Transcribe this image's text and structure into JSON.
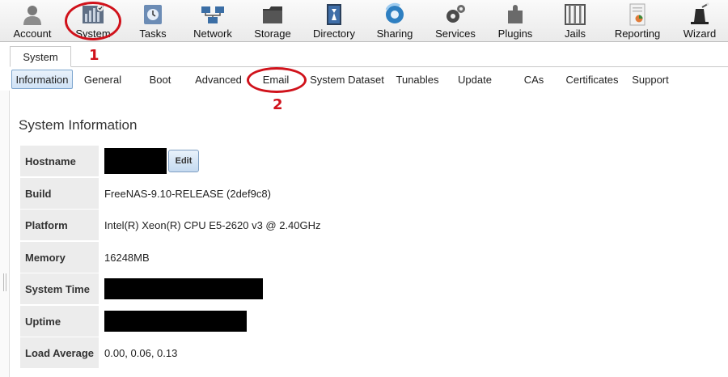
{
  "toolbar": {
    "items": [
      {
        "label": "Account",
        "icon": "account-icon"
      },
      {
        "label": "System",
        "icon": "system-icon"
      },
      {
        "label": "Tasks",
        "icon": "tasks-icon"
      },
      {
        "label": "Network",
        "icon": "network-icon"
      },
      {
        "label": "Storage",
        "icon": "storage-icon"
      },
      {
        "label": "Directory",
        "icon": "directory-icon"
      },
      {
        "label": "Sharing",
        "icon": "sharing-icon"
      },
      {
        "label": "Services",
        "icon": "services-icon"
      },
      {
        "label": "Plugins",
        "icon": "plugins-icon"
      },
      {
        "label": "Jails",
        "icon": "jails-icon"
      },
      {
        "label": "Reporting",
        "icon": "reporting-icon"
      },
      {
        "label": "Wizard",
        "icon": "wizard-icon"
      }
    ]
  },
  "tabs": {
    "main": "System"
  },
  "subtabs": [
    {
      "label": "Information",
      "active": true
    },
    {
      "label": "General"
    },
    {
      "label": "Boot"
    },
    {
      "label": "Advanced"
    },
    {
      "label": "Email"
    },
    {
      "label": "System Dataset"
    },
    {
      "label": "Tunables"
    },
    {
      "label": "Update"
    },
    {
      "label": "CAs"
    },
    {
      "label": "Certificates"
    },
    {
      "label": "Support"
    }
  ],
  "annotations": {
    "mark1": "1",
    "mark2": "2",
    "color": "#d0121b"
  },
  "panel": {
    "title": "System Information",
    "edit_label": "Edit",
    "rows": [
      {
        "label": "Hostname",
        "value": ""
      },
      {
        "label": "Build",
        "value": "FreeNAS-9.10-RELEASE (2def9c8)"
      },
      {
        "label": "Platform",
        "value": "Intel(R) Xeon(R) CPU E5-2620 v3 @ 2.40GHz"
      },
      {
        "label": "Memory",
        "value": "16248MB"
      },
      {
        "label": "System Time",
        "value": ""
      },
      {
        "label": "Uptime",
        "value": ""
      },
      {
        "label": "Load Average",
        "value": "0.00, 0.06, 0.13"
      }
    ]
  },
  "colors": {
    "accent": "#7da6cf",
    "label_bg": "#ececec"
  }
}
